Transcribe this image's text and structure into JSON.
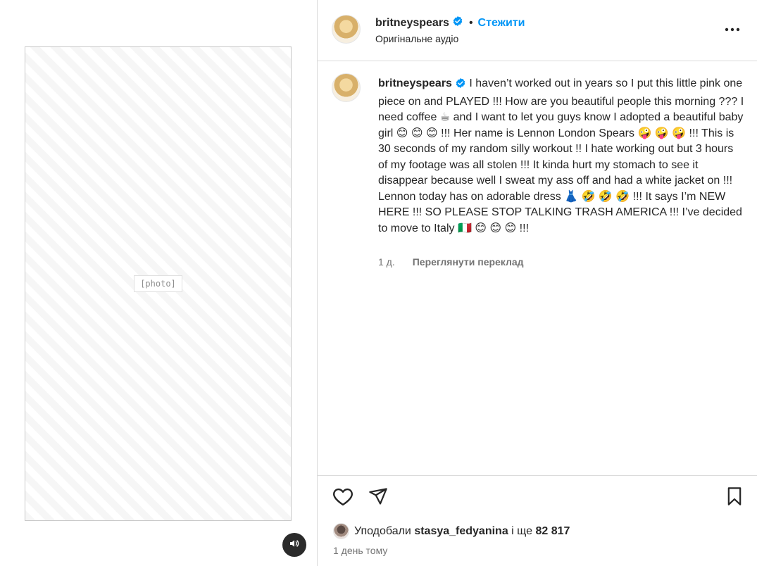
{
  "post": {
    "username": "britneyspears",
    "follow_label": "Стежити",
    "audio_label": "Оригінальне аудіо",
    "separator": "•"
  },
  "media": {
    "photo_label": "[photo]",
    "mute_icon": "speaker-icon"
  },
  "caption": {
    "username": "britneyspears",
    "text": "I haven’t worked out in years so I put this little pink one piece on and PLAYED !!! How are you beautiful people this morning ??? I need coffee ☕ and I want to let you guys know I adopted a beautiful baby girl 😊 😊 😊 !!! Her name is Lennon London Spears 🤪 🤪 🤪 !!! This is 30 seconds of my random silly workout !! I hate working out but 3 hours of my footage was all stolen !!! It kinda hurt my stomach to see it disappear because well I sweat my ass off and had a white jacket on !!!  Lennon today has on adorable dress 👗 🤣 🤣 🤣 !!! It says I’m NEW HERE !!! SO PLEASE STOP TALKING TRASH AMERICA !!! I’ve decided to move to Italy 🇮🇹 😊 😊 😊 !!!",
    "age": "1 д.",
    "translate_label": "Переглянути переклад"
  },
  "actions": {
    "like_icon": "heart-icon",
    "share_icon": "send-icon",
    "save_icon": "bookmark-icon"
  },
  "likes": {
    "prefix": "Уподобали",
    "user": "stasya_fedyanina",
    "suffix": "і ще",
    "count": "82 817"
  },
  "timestamp": "1 день тому",
  "colors": {
    "accent": "#0095f6",
    "verified": "#0095f6",
    "text": "#262626",
    "muted": "#737373",
    "divider": "#dbdbdb"
  }
}
